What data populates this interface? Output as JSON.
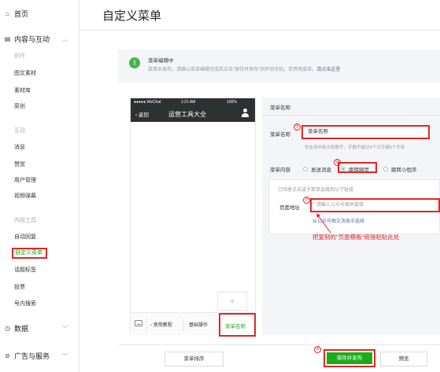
{
  "sidebar": {
    "home": "首页",
    "content_section": "内容与互动",
    "items": [
      {
        "label": "创作",
        "kind": "category"
      },
      {
        "label": "图文素材",
        "kind": "item"
      },
      {
        "label": "素材库",
        "kind": "item"
      },
      {
        "label": "原创",
        "kind": "item"
      },
      {
        "label": "互动",
        "kind": "category"
      },
      {
        "label": "消息",
        "kind": "item"
      },
      {
        "label": "赞赏",
        "kind": "item"
      },
      {
        "label": "用户管理",
        "kind": "item"
      },
      {
        "label": "视频弹幕",
        "kind": "item"
      },
      {
        "label": "内容工具",
        "kind": "category"
      },
      {
        "label": "自动回复",
        "kind": "item"
      },
      {
        "label": "自定义菜单",
        "kind": "active"
      },
      {
        "label": "话题标签",
        "kind": "item"
      },
      {
        "label": "投票",
        "kind": "item"
      },
      {
        "label": "号内搜索",
        "kind": "item"
      }
    ],
    "data_section": "数据",
    "ads_section": "广告与服务"
  },
  "page_title": "自定义菜单",
  "notice": {
    "icon": "info-icon",
    "title": "菜单编辑中",
    "text": "菜单未发布，请确认菜单编辑完成后点击\"保存并发布\"同步到手机。若停用菜单，",
    "link": "请点击这里"
  },
  "phone": {
    "carrier": "●●●●● WeChat",
    "time": "1:21 AM",
    "battery": "100%",
    "back": "返回",
    "title": "运营工具大全",
    "add": "+",
    "menu_items": [
      "使用教程",
      "基础操作",
      "菜单名称"
    ]
  },
  "editor": {
    "header": "菜单名称",
    "name_label": "菜单名称",
    "name_value": "菜单名称",
    "name_hint": "仅支持中英文和数字，字数不超过4个汉字或8个字母",
    "content_label": "菜单内容",
    "options": [
      "发送消息",
      "跳转网页",
      "跳转小程序"
    ],
    "selected_option": "跳转网页",
    "subscriber_hint": "订阅者点击该子菜单会跳到以下链接",
    "url_label": "页面地址",
    "url_placeholder": "请输入公众号相关链接",
    "url_link": "从公众号图文消息中选择"
  },
  "annotation": "把复制的\"页面模板\"链接粘贴此处",
  "markers": [
    "①",
    "②",
    "③",
    "④"
  ],
  "buttons": {
    "sort": "菜单排序",
    "save": "保存并发布",
    "preview": "预览"
  },
  "colors": {
    "brand_green": "#1aad19",
    "highlight_red": "#e32525",
    "link_blue": "#576b95"
  }
}
